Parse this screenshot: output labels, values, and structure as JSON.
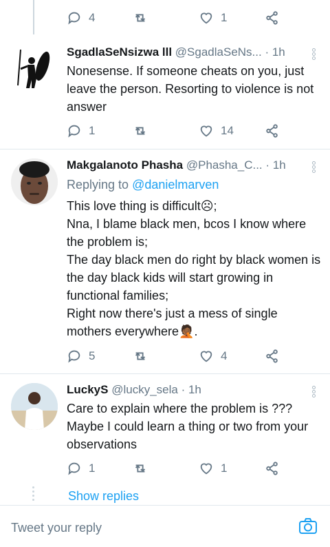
{
  "top_actions": {
    "reply_count": "4",
    "retweet_count": "",
    "like_count": "1"
  },
  "tweets": [
    {
      "name": "SgadlaSeNsizwa lll",
      "handle": "@SgadlaSeNs...",
      "time": "· 1h",
      "text": "Nonesense. If someone cheats on you, just leave the person. Resorting to violence is not answer",
      "reply_count": "1",
      "like_count": "14"
    },
    {
      "name": "Makgalanoto Phasha",
      "handle": "@Phasha_C...",
      "time": "· 1h",
      "replying_prefix": "Replying to ",
      "replying_to": "@danielmarven",
      "lines": [
        "This love thing is difficult☹;",
        "Nna, I blame black men, bcos I know where the problem is;",
        "The day black men do right by black women is the day black kids will start growing in functional families;",
        "Right now there's just a mess of single mothers everywhere🤦🏾.",
        ""
      ],
      "reply_count": "5",
      "like_count": "4"
    },
    {
      "name": "LuckyS",
      "handle": "@lucky_sela",
      "time": "· 1h",
      "text": "Care to explain where the problem is ??? Maybe I could learn a thing or two from your observations",
      "reply_count": "1",
      "like_count": "1"
    }
  ],
  "show_replies": "Show replies",
  "compose": {
    "placeholder": "Tweet your reply"
  },
  "colors": {
    "accent": "#1da1f2",
    "muted": "#657786",
    "divider": "#e1e8ed"
  }
}
